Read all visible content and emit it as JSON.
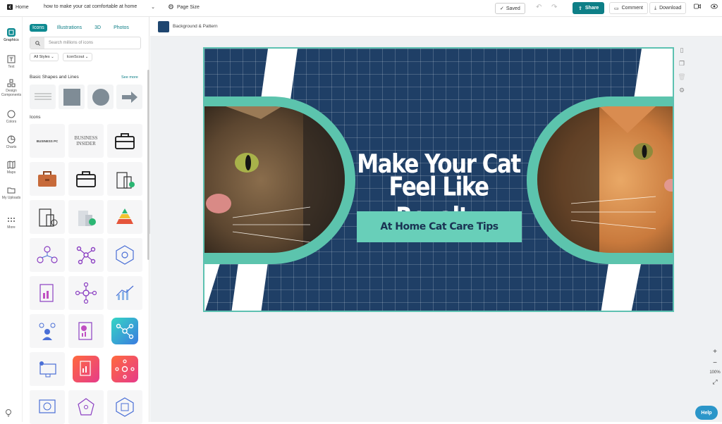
{
  "topbar": {
    "home_label": "Home",
    "doc_title": "how to make your cat comfortable at home",
    "page_size_label": "Page Size",
    "saved_label": "Saved",
    "share_label": "Share",
    "comment_label": "Comment",
    "download_label": "Download"
  },
  "rail": {
    "items": [
      {
        "label": "Graphics",
        "icon": "graphics-icon"
      },
      {
        "label": "Text",
        "icon": "text-icon"
      },
      {
        "label": "Design Components",
        "icon": "components-icon"
      },
      {
        "label": "Colors",
        "icon": "palette-icon"
      },
      {
        "label": "Charts",
        "icon": "chart-icon"
      },
      {
        "label": "Maps",
        "icon": "map-icon"
      },
      {
        "label": "My Uploads",
        "icon": "folder-icon"
      },
      {
        "label": "More",
        "icon": "more-icon"
      }
    ]
  },
  "panel": {
    "tabs": [
      "Icons",
      "Illustrations",
      "3D",
      "Photos"
    ],
    "search_placeholder": "Search millions of icons",
    "filter_styles": "All Styles",
    "filter_source": "IconScout",
    "basic_shapes_title": "Basic Shapes and Lines",
    "see_more": "See more",
    "icons_title": "Icons",
    "business_pc": "BUSINESS PC",
    "business_insider_1": "BUSINESS",
    "business_insider_2": "INSIDER"
  },
  "canvas": {
    "bg_label": "Background & Pattern",
    "title_line1": "Make Your Cat",
    "title_line2": "Feel Like Royalty",
    "subtitle": "At Home Cat Care Tips",
    "zoom": "100%"
  },
  "help_label": "Help",
  "colors": {
    "accent": "#0e8a91",
    "navy": "#1f3f66",
    "mint": "#68cfb9"
  }
}
